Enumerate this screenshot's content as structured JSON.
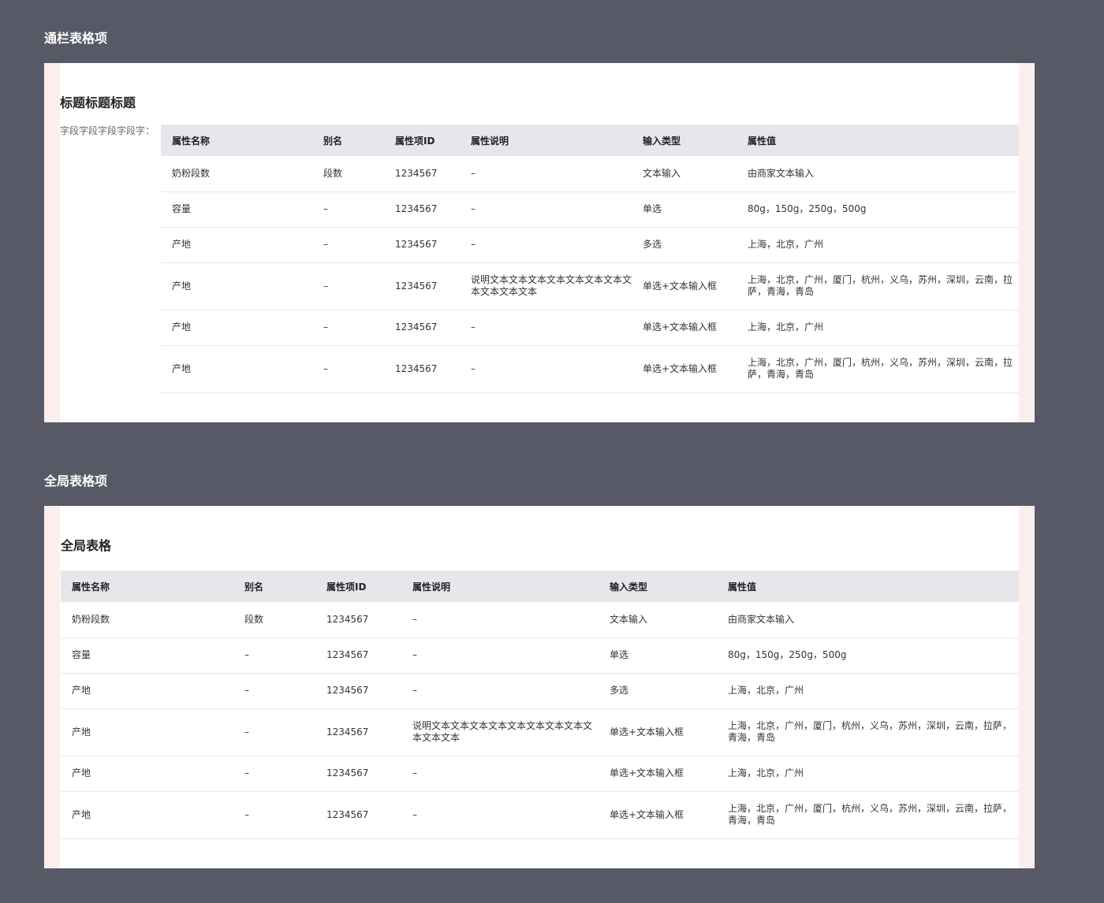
{
  "sections": [
    {
      "label": "通栏表格项",
      "title": "标题标题标题",
      "field_label": "字段字段字段字段字："
    },
    {
      "label": "全局表格项",
      "title": "全局表格"
    }
  ],
  "table": {
    "headers": [
      "属性名称",
      "别名",
      "属性项ID",
      "属性说明",
      "输入类型",
      "属性值"
    ],
    "rows": [
      [
        "奶粉段数",
        "段数",
        "1234567",
        "–",
        "文本输入",
        "由商家文本输入"
      ],
      [
        "容量",
        "–",
        "1234567",
        "–",
        "单选",
        "80g，150g，250g，500g"
      ],
      [
        "产地",
        "–",
        "1234567",
        "–",
        "多选",
        "上海，北京，广州"
      ],
      [
        "产地",
        "–",
        "1234567",
        "说明文本文本文本文本文本文本文本文本文本文本文本",
        "单选+文本输入框",
        "上海，北京，广州，厦门，杭州，义乌，苏州，深圳，云南，拉萨，青海，青岛"
      ],
      [
        "产地",
        "–",
        "1234567",
        "–",
        "单选+文本输入框",
        "上海，北京，广州"
      ],
      [
        "产地",
        "–",
        "1234567",
        "–",
        "单选+文本输入框",
        "上海，北京，广州，厦门，杭州，义乌，苏州，深圳，云南，拉萨，青海，青岛"
      ]
    ]
  },
  "colors": {
    "page_bg": "#575a66",
    "panel_border": "#fdeeee",
    "header_bg": "#e6e7eb"
  }
}
